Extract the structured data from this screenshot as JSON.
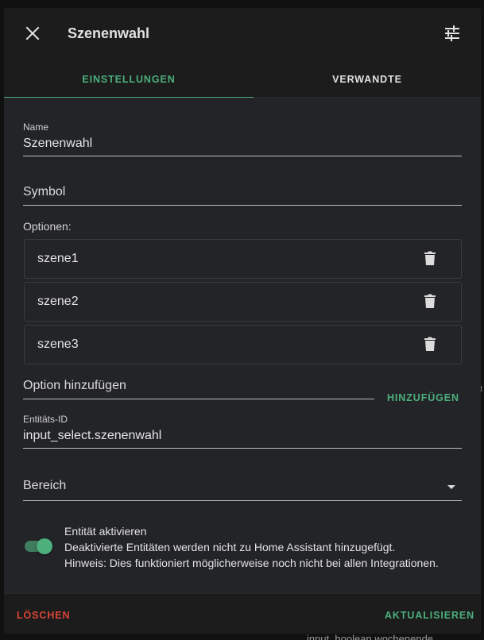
{
  "header": {
    "title": "Szenenwahl",
    "close_icon": "close-icon",
    "settings_icon": "tune-icon"
  },
  "tabs": [
    {
      "label": "EINSTELLUNGEN",
      "active": true
    },
    {
      "label": "VERWANDTE",
      "active": false
    }
  ],
  "form": {
    "name": {
      "label": "Name",
      "value": "Szenenwahl"
    },
    "symbol": {
      "placeholder": "Symbol"
    },
    "options_label": "Optionen:",
    "options": [
      {
        "label": "szene1"
      },
      {
        "label": "szene2"
      },
      {
        "label": "szene3"
      }
    ],
    "add_option": {
      "placeholder": "Option hinzufügen",
      "button": "HINZUFÜGEN"
    },
    "entity_id": {
      "label": "Entitäts-ID",
      "value": "input_select.szenenwahl"
    },
    "area": {
      "placeholder": "Bereich"
    },
    "enable": {
      "title": "Entität aktivieren",
      "description": "Deaktivierte Entitäten werden nicht zu Home Assistant hinzugefügt.",
      "note": "Hinweis: Dies funktioniert möglicherweise noch nicht bei allen Integrationen.",
      "checked": true
    }
  },
  "footer": {
    "delete": "LÖSCHEN",
    "update": "AKTUALISIEREN"
  },
  "background": {
    "partial_text": "input_boolean.wochenende"
  },
  "colors": {
    "accent": "#4caf7c",
    "danger": "#db4437"
  }
}
